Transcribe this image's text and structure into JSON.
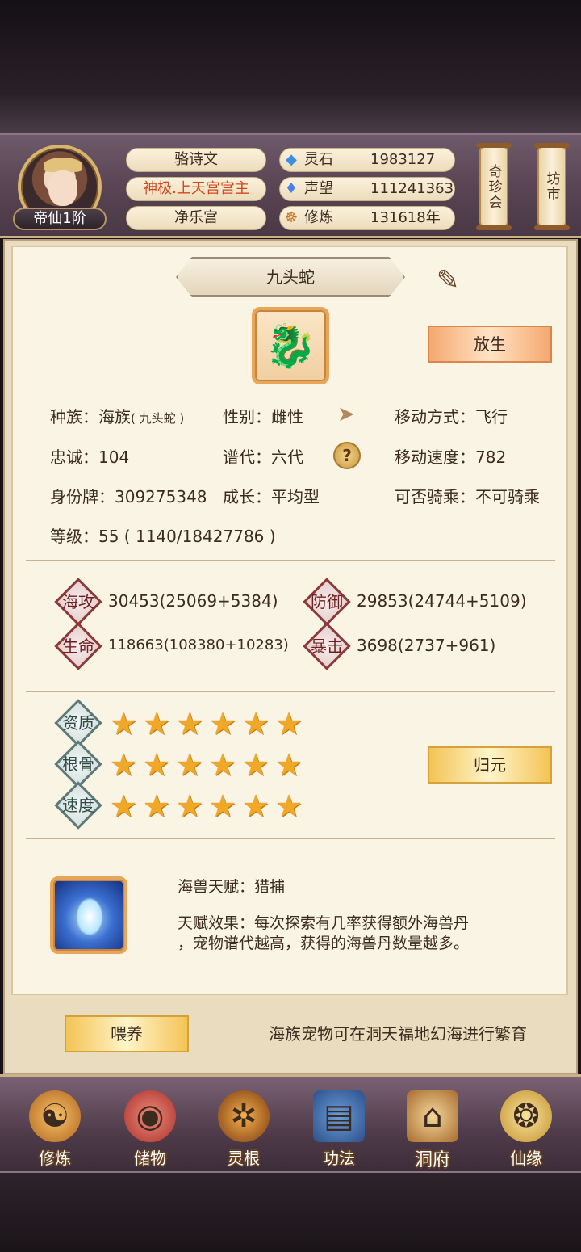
{
  "header": {
    "rank": "帝仙1阶",
    "player_name": "骆诗文",
    "player_title": "神极.上天宫宫主",
    "sect": "净乐宫",
    "resources": [
      {
        "label": "灵石",
        "value": "1983127",
        "icon": "spirit-stone-icon"
      },
      {
        "label": "声望",
        "value": "111241363",
        "icon": "reputation-crystal-icon"
      },
      {
        "label": "修炼",
        "value": "131618年",
        "icon": "meditation-icon"
      }
    ],
    "shortcuts": [
      "奇珍会",
      "坊市"
    ]
  },
  "pet": {
    "name": "九头蛇",
    "release_label": "放生",
    "race_label": "种族：",
    "race_value": "海族",
    "race_sub": "( 九头蛇 )",
    "gender": "性别：雌性",
    "move_type": "移动方式：飞行",
    "loyalty": "忠诚：104",
    "generation": "谱代：六代",
    "move_speed": "移动速度：782",
    "id_tag": "身份牌：309275348",
    "growth": "成长：平均型",
    "rideable": "可否骑乘：不可骑乘",
    "level": "等级：55 ( 1140/18427786 )"
  },
  "stats": [
    {
      "label": "海攻",
      "value": "30453(25069+5384)"
    },
    {
      "label": "防御",
      "value": "29853(24744+5109)"
    },
    {
      "label": "生命",
      "value": "118663(108380+10283)"
    },
    {
      "label": "暴击",
      "value": "3698(2737+961)"
    }
  ],
  "aptitudes": [
    {
      "label": "资质",
      "stars": 6
    },
    {
      "label": "根骨",
      "stars": 6
    },
    {
      "label": "速度",
      "stars": 6
    }
  ],
  "reset_label": "归元",
  "talent": {
    "title": "海兽天赋：猎捕",
    "effect_line1": "天赋效果：每次探索有几率获得额外海兽丹",
    "effect_line2": "，宠物谱代越高，获得的海兽丹数量越多。"
  },
  "feed_label": "喂养",
  "breed_note": "海族宠物可在洞天福地幻海进行繁育",
  "nav": [
    {
      "label": "修炼",
      "icon": "cultivate-icon"
    },
    {
      "label": "储物",
      "icon": "storage-bag-icon"
    },
    {
      "label": "灵根",
      "icon": "spirit-root-icon"
    },
    {
      "label": "功法",
      "icon": "skill-book-icon"
    },
    {
      "label": "洞府",
      "icon": "cave-mansion-icon"
    },
    {
      "label": "仙缘",
      "icon": "immortal-fate-icon"
    }
  ],
  "colors": {
    "title_red": "#d2481d",
    "star_gold": "#f2a827",
    "stat_red_border": "#8a3a3a",
    "aptitude_green_border": "#5d7a78"
  }
}
